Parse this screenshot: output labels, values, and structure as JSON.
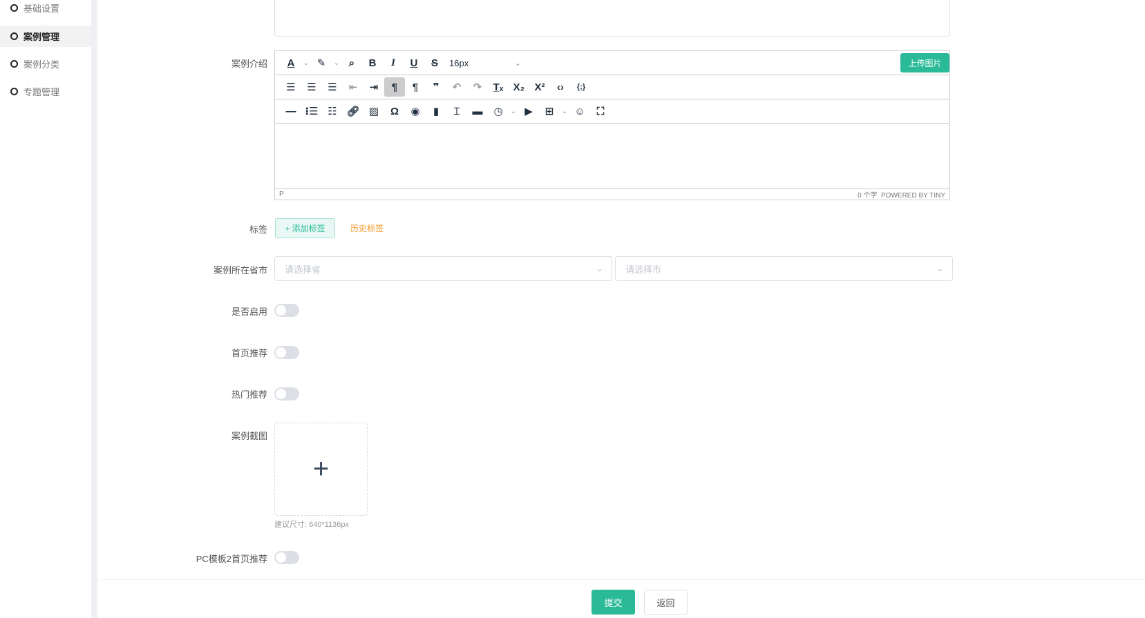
{
  "sidebar": {
    "items": [
      {
        "label": "基础设置"
      },
      {
        "label": "案例管理",
        "active": true
      },
      {
        "label": "案例分类"
      },
      {
        "label": "专题管理"
      }
    ]
  },
  "form": {
    "intro_label": "案例介绍",
    "editor": {
      "font_size": "16px",
      "upload_button": "上传图片",
      "path": "P",
      "word_count": "0 个字",
      "powered": "POWERED BY TINY"
    },
    "tags_label": "标签",
    "add_tag": "+ 添加标签",
    "history_tags": "历史标签",
    "region_label": "案例所在省市",
    "province_placeholder": "请选择省",
    "city_placeholder": "请选择市",
    "enabled_label": "是否启用",
    "enabled": false,
    "home_rec_label": "首页推荐",
    "home_rec": false,
    "hot_rec_label": "热门推荐",
    "hot_rec": false,
    "screenshot_label": "案例截图",
    "screenshot_hint": "建议尺寸: 640*1136px",
    "pc2_label": "PC模板2首页推荐",
    "pc2": false
  },
  "footer": {
    "submit": "提交",
    "back": "返回"
  },
  "colors": {
    "accent": "#2bba98",
    "history": "#f39a2b"
  }
}
